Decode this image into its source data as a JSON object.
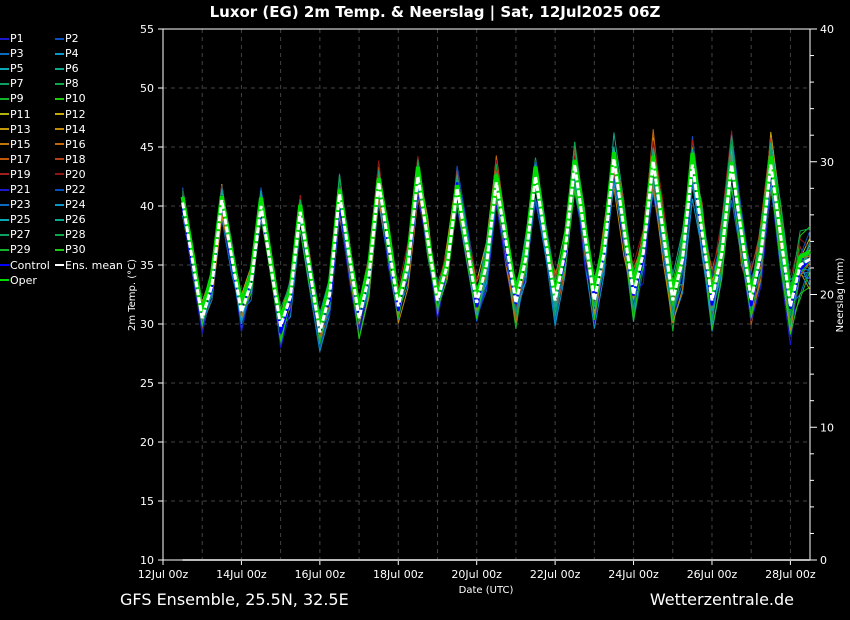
{
  "chart_data": {
    "type": "line",
    "title": "Luxor  (EG)  2m Temp. & Neerslag | Sat, 12Jul2025 06Z",
    "xlabel": "Date (UTC)",
    "ylabel": "2m Temp. (°C)",
    "y2label": "Neerslag (mm)",
    "ylim": [
      10,
      55
    ],
    "y2lim": [
      0,
      40
    ],
    "yticks": [
      "10",
      "15",
      "20",
      "25",
      "30",
      "35",
      "40",
      "45",
      "50",
      "55"
    ],
    "y2ticks": [
      "0",
      "10",
      "20",
      "30",
      "40"
    ],
    "xticks": [
      "12Jul 00z",
      "14Jul 00z",
      "16Jul 00z",
      "18Jul 00z",
      "20Jul 00z",
      "22Jul 00z",
      "24Jul 00z",
      "26Jul 00z",
      "28Jul 00z"
    ],
    "x_start_days": 0.5,
    "x_step_days": 0.25,
    "x_range_days": [
      0,
      16.5
    ],
    "grid": true,
    "ens_mean": [
      40.3,
      35.4,
      30.5,
      33.3,
      40.5,
      35.7,
      31,
      33.5,
      40,
      34.9,
      29.8,
      32.3,
      39.5,
      34.4,
      29.3,
      32.5,
      41,
      35.7,
      30.5,
      34,
      42,
      36.7,
      31.5,
      35,
      42.5,
      37.2,
      32,
      35,
      41.5,
      36.6,
      31.8,
      35,
      42,
      36.9,
      31.8,
      35.5,
      42.5,
      37.2,
      32,
      36,
      43.5,
      37.7,
      32,
      36,
      44,
      38.2,
      32.5,
      36,
      43.8,
      37.9,
      32,
      35.5,
      43.5,
      37.7,
      32,
      36,
      43.5,
      37.7,
      32,
      36,
      43.5,
      37.5,
      31.5,
      35,
      35.5
    ],
    "member_spread_c": 1.6,
    "precipitation_mm": 0,
    "series": [
      {
        "name": "P1",
        "color": "#1a1acc"
      },
      {
        "name": "P2",
        "color": "#0a4fc0"
      },
      {
        "name": "P3",
        "color": "#0a6cc0"
      },
      {
        "name": "P4",
        "color": "#0a96c8"
      },
      {
        "name": "P5",
        "color": "#0aaab4"
      },
      {
        "name": "P6",
        "color": "#0aa88c"
      },
      {
        "name": "P7",
        "color": "#0aa060"
      },
      {
        "name": "P8",
        "color": "#0aa84a"
      },
      {
        "name": "P9",
        "color": "#12b42a"
      },
      {
        "name": "P10",
        "color": "#1ec812"
      },
      {
        "name": "P11",
        "color": "#b4b40a"
      },
      {
        "name": "P12",
        "color": "#c4a80a"
      },
      {
        "name": "P13",
        "color": "#c49a0a"
      },
      {
        "name": "P14",
        "color": "#c4880a"
      },
      {
        "name": "P15",
        "color": "#c4780a"
      },
      {
        "name": "P16",
        "color": "#c0660a"
      },
      {
        "name": "P17",
        "color": "#c0580a"
      },
      {
        "name": "P18",
        "color": "#b4401a"
      },
      {
        "name": "P19",
        "color": "#a02020"
      },
      {
        "name": "P20",
        "color": "#901414"
      },
      {
        "name": "P21",
        "color": "#1a1acc"
      },
      {
        "name": "P22",
        "color": "#0a4fc0"
      },
      {
        "name": "P23",
        "color": "#0a6cc0"
      },
      {
        "name": "P24",
        "color": "#0a96c8"
      },
      {
        "name": "P25",
        "color": "#0aaab4"
      },
      {
        "name": "P26",
        "color": "#0aa88c"
      },
      {
        "name": "P27",
        "color": "#0aa060"
      },
      {
        "name": "P28",
        "color": "#0aa84a"
      },
      {
        "name": "P29",
        "color": "#12b42a"
      },
      {
        "name": "P30",
        "color": "#1ec812"
      },
      {
        "name": "Control",
        "color": "#0000ff"
      },
      {
        "name": "Ens. mean",
        "color": "#ffffff"
      },
      {
        "name": "Oper",
        "color": "#00dd00"
      }
    ]
  },
  "footer": {
    "left": "GFS Ensemble, 25.5N, 32.5E",
    "right": "Wetterzentrale.de"
  }
}
